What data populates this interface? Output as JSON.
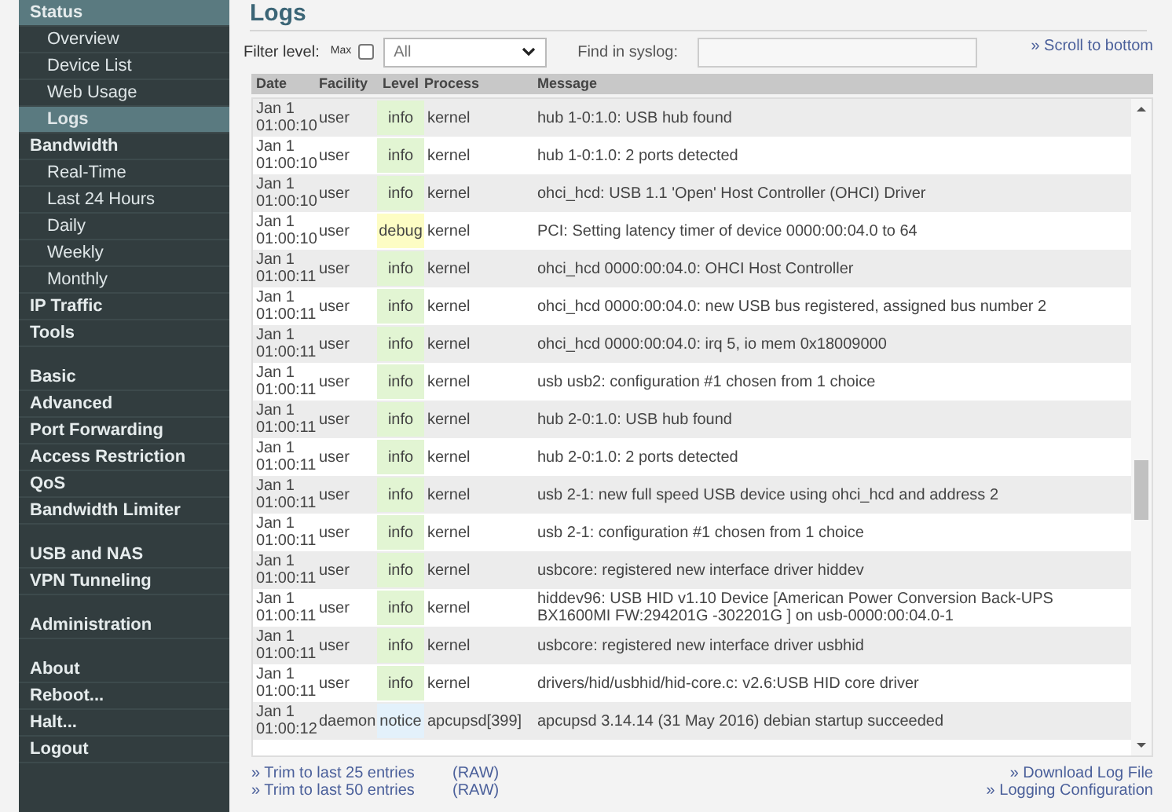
{
  "sidebar": {
    "groups": [
      [
        {
          "label": "Status",
          "kind": "heading",
          "selected": true
        },
        {
          "label": "Overview",
          "kind": "sub",
          "selected": false
        },
        {
          "label": "Device List",
          "kind": "sub",
          "selected": false
        },
        {
          "label": "Web Usage",
          "kind": "sub",
          "selected": false
        },
        {
          "label": "Logs",
          "kind": "sub",
          "selected": true
        },
        {
          "label": "Bandwidth",
          "kind": "heading",
          "selected": false
        },
        {
          "label": "Real-Time",
          "kind": "sub",
          "selected": false
        },
        {
          "label": "Last 24 Hours",
          "kind": "sub",
          "selected": false
        },
        {
          "label": "Daily",
          "kind": "sub",
          "selected": false
        },
        {
          "label": "Weekly",
          "kind": "sub",
          "selected": false
        },
        {
          "label": "Monthly",
          "kind": "sub",
          "selected": false
        },
        {
          "label": "IP Traffic",
          "kind": "heading",
          "selected": false
        },
        {
          "label": "Tools",
          "kind": "heading",
          "selected": false
        }
      ],
      [
        {
          "label": "Basic",
          "kind": "heading",
          "selected": false
        },
        {
          "label": "Advanced",
          "kind": "heading",
          "selected": false
        },
        {
          "label": "Port Forwarding",
          "kind": "heading",
          "selected": false
        },
        {
          "label": "Access Restriction",
          "kind": "heading",
          "selected": false
        },
        {
          "label": "QoS",
          "kind": "heading",
          "selected": false
        },
        {
          "label": "Bandwidth Limiter",
          "kind": "heading",
          "selected": false
        }
      ],
      [
        {
          "label": "USB and NAS",
          "kind": "heading",
          "selected": false
        },
        {
          "label": "VPN Tunneling",
          "kind": "heading",
          "selected": false
        }
      ],
      [
        {
          "label": "Administration",
          "kind": "heading",
          "selected": false
        }
      ],
      [
        {
          "label": "About",
          "kind": "heading",
          "selected": false
        },
        {
          "label": "Reboot...",
          "kind": "heading",
          "selected": false
        },
        {
          "label": "Halt...",
          "kind": "heading",
          "selected": false
        },
        {
          "label": "Logout",
          "kind": "heading",
          "selected": false
        }
      ]
    ]
  },
  "page_title": "Logs",
  "filter": {
    "label": "Filter level:",
    "max_label": "Max",
    "max_checked": false,
    "level_select": "All",
    "find_label": "Find in syslog:",
    "scroll_link": "» Scroll to bottom"
  },
  "table": {
    "columns": [
      "Date",
      "Facility",
      "Level",
      "Process",
      "Message"
    ],
    "rows": [
      {
        "date": "Jan 1\n01:00:10",
        "facility": "user",
        "level": "info",
        "color": "#e2f5d3",
        "process": "kernel",
        "message": "hub 1-0:1.0: USB hub found"
      },
      {
        "date": "Jan 1\n01:00:10",
        "facility": "user",
        "level": "info",
        "color": "#e2f5d3",
        "process": "kernel",
        "message": "hub 1-0:1.0: 2 ports detected"
      },
      {
        "date": "Jan 1\n01:00:10",
        "facility": "user",
        "level": "info",
        "color": "#e2f5d3",
        "process": "kernel",
        "message": "ohci_hcd: USB 1.1 'Open' Host Controller (OHCI) Driver"
      },
      {
        "date": "Jan 1\n01:00:10",
        "facility": "user",
        "level": "debug",
        "color": "#fdfdc4",
        "process": "kernel",
        "message": "PCI: Setting latency timer of device 0000:00:04.0 to 64"
      },
      {
        "date": "Jan 1\n01:00:11",
        "facility": "user",
        "level": "info",
        "color": "#e2f5d3",
        "process": "kernel",
        "message": "ohci_hcd 0000:00:04.0: OHCI Host Controller"
      },
      {
        "date": "Jan 1\n01:00:11",
        "facility": "user",
        "level": "info",
        "color": "#e2f5d3",
        "process": "kernel",
        "message": "ohci_hcd 0000:00:04.0: new USB bus registered, assigned bus number 2"
      },
      {
        "date": "Jan 1\n01:00:11",
        "facility": "user",
        "level": "info",
        "color": "#e2f5d3",
        "process": "kernel",
        "message": "ohci_hcd 0000:00:04.0: irq 5, io mem 0x18009000"
      },
      {
        "date": "Jan 1\n01:00:11",
        "facility": "user",
        "level": "info",
        "color": "#e2f5d3",
        "process": "kernel",
        "message": "usb usb2: configuration #1 chosen from 1 choice"
      },
      {
        "date": "Jan 1\n01:00:11",
        "facility": "user",
        "level": "info",
        "color": "#e2f5d3",
        "process": "kernel",
        "message": "hub 2-0:1.0: USB hub found"
      },
      {
        "date": "Jan 1\n01:00:11",
        "facility": "user",
        "level": "info",
        "color": "#e2f5d3",
        "process": "kernel",
        "message": "hub 2-0:1.0: 2 ports detected"
      },
      {
        "date": "Jan 1\n01:00:11",
        "facility": "user",
        "level": "info",
        "color": "#e2f5d3",
        "process": "kernel",
        "message": "usb 2-1: new full speed USB device using ohci_hcd and address 2"
      },
      {
        "date": "Jan 1\n01:00:11",
        "facility": "user",
        "level": "info",
        "color": "#e2f5d3",
        "process": "kernel",
        "message": "usb 2-1: configuration #1 chosen from 1 choice"
      },
      {
        "date": "Jan 1\n01:00:11",
        "facility": "user",
        "level": "info",
        "color": "#e2f5d3",
        "process": "kernel",
        "message": "usbcore: registered new interface driver hiddev"
      },
      {
        "date": "Jan 1\n01:00:11",
        "facility": "user",
        "level": "info",
        "color": "#e2f5d3",
        "process": "kernel",
        "message": "hiddev96: USB HID v1.10 Device [American Power Conversion Back-UPS BX1600MI FW:294201G -302201G ] on usb-0000:00:04.0-1"
      },
      {
        "date": "Jan 1\n01:00:11",
        "facility": "user",
        "level": "info",
        "color": "#e2f5d3",
        "process": "kernel",
        "message": "usbcore: registered new interface driver usbhid"
      },
      {
        "date": "Jan 1\n01:00:11",
        "facility": "user",
        "level": "info",
        "color": "#e2f5d3",
        "process": "kernel",
        "message": "drivers/hid/usbhid/hid-core.c: v2.6:USB HID core driver"
      },
      {
        "date": "Jan 1\n01:00:12",
        "facility": "daemon",
        "level": "notice",
        "color": "#e3f1fb",
        "process": "apcupsd[399]",
        "message": "apcupsd 3.14.14 (31 May 2016) debian startup succeeded"
      }
    ]
  },
  "footer": {
    "left": [
      {
        "link": "» Trim to last 25 entries",
        "raw": "(RAW)"
      },
      {
        "link": "» Trim to last 50 entries",
        "raw": "(RAW)"
      }
    ],
    "right": [
      "» Download Log File",
      "» Logging Configuration"
    ]
  }
}
